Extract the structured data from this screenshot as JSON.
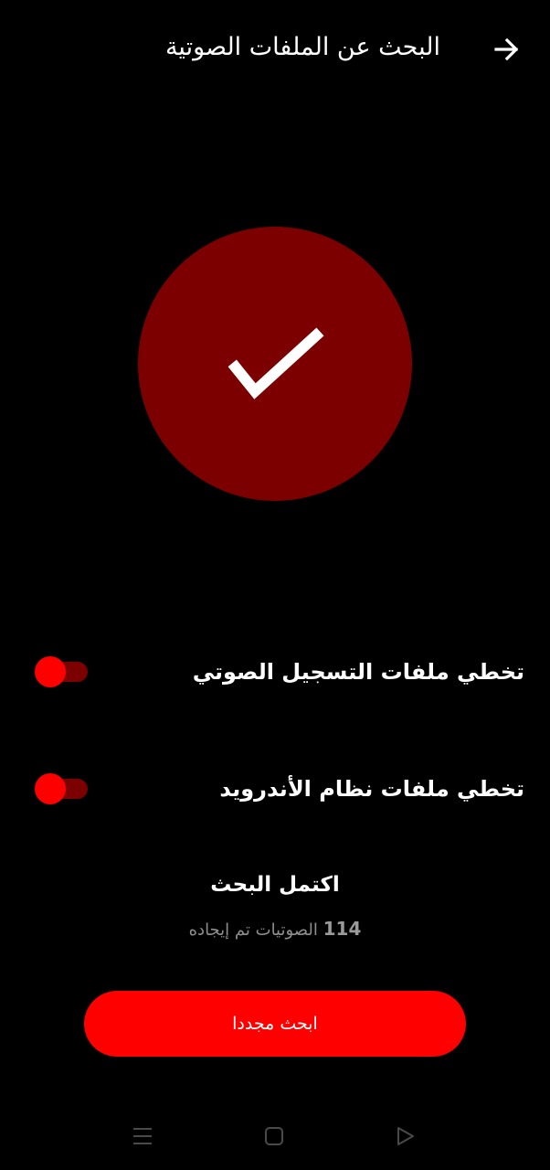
{
  "header": {
    "title": "البحث عن الملفات الصوتية",
    "back_icon": "arrow-right-icon"
  },
  "status_icon": "checkmark-icon",
  "colors": {
    "background": "#000000",
    "accent": "#ff0000",
    "accent_dark": "#7d0000",
    "muted_text": "#8e8e8e"
  },
  "options": [
    {
      "label": "تخطي ملفات التسجيل الصوتي",
      "enabled": true
    },
    {
      "label": "تخطي ملفات نظام الأندرويد",
      "enabled": true
    }
  ],
  "status": {
    "title": "اكتمل البحث",
    "count": "114",
    "count_suffix": "الصوتيات تم إيجاده"
  },
  "actions": {
    "search_again_label": "ابحث مجددا"
  },
  "nav": {
    "recents_icon": "menu-icon",
    "home_icon": "home-square-icon",
    "back_icon": "back-triangle-icon"
  }
}
